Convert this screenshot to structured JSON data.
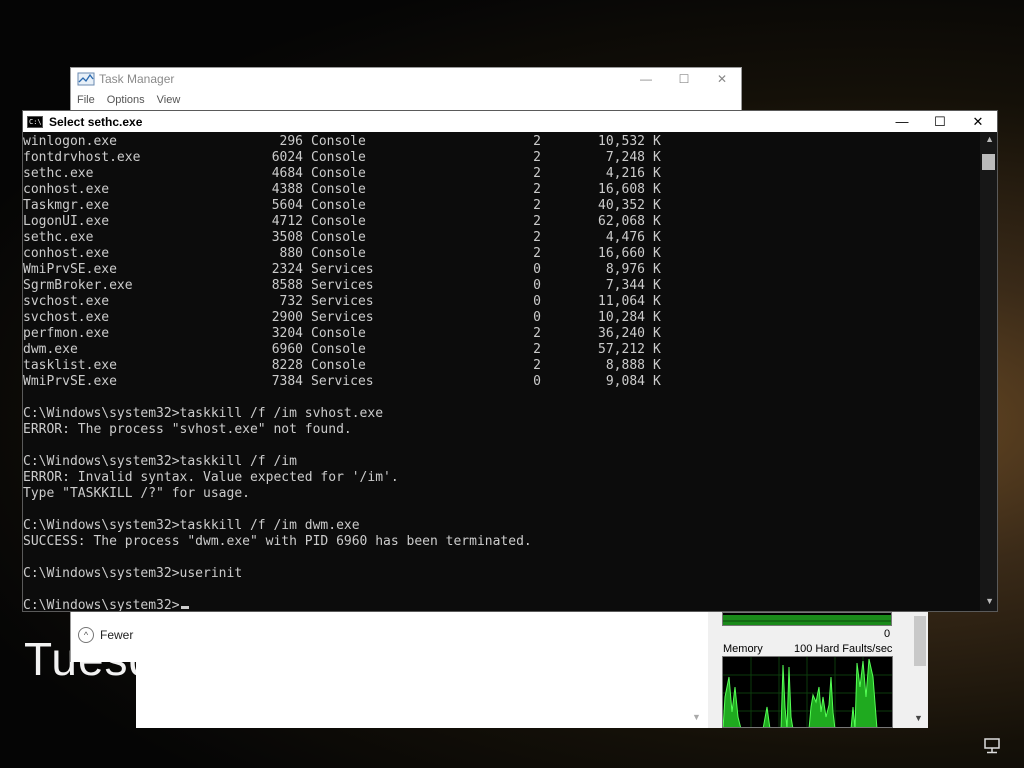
{
  "lock_screen": {
    "day_text": "Tuesd"
  },
  "task_manager": {
    "title": "Task Manager",
    "menu": [
      "File",
      "Options",
      "View"
    ],
    "fewer_details": "Fewer",
    "perf": {
      "zero_label": "0",
      "memory_label": "Memory",
      "faults_label": "100 Hard Faults/sec"
    }
  },
  "console": {
    "title": "Select sethc.exe",
    "processes": [
      {
        "name": "winlogon.exe",
        "pid": "296",
        "session": "Console",
        "num": "2",
        "mem": "10,532",
        "unit": "K"
      },
      {
        "name": "fontdrvhost.exe",
        "pid": "6024",
        "session": "Console",
        "num": "2",
        "mem": "7,248",
        "unit": "K"
      },
      {
        "name": "sethc.exe",
        "pid": "4684",
        "session": "Console",
        "num": "2",
        "mem": "4,216",
        "unit": "K"
      },
      {
        "name": "conhost.exe",
        "pid": "4388",
        "session": "Console",
        "num": "2",
        "mem": "16,608",
        "unit": "K"
      },
      {
        "name": "Taskmgr.exe",
        "pid": "5604",
        "session": "Console",
        "num": "2",
        "mem": "40,352",
        "unit": "K"
      },
      {
        "name": "LogonUI.exe",
        "pid": "4712",
        "session": "Console",
        "num": "2",
        "mem": "62,068",
        "unit": "K"
      },
      {
        "name": "sethc.exe",
        "pid": "3508",
        "session": "Console",
        "num": "2",
        "mem": "4,476",
        "unit": "K"
      },
      {
        "name": "conhost.exe",
        "pid": "880",
        "session": "Console",
        "num": "2",
        "mem": "16,660",
        "unit": "K"
      },
      {
        "name": "WmiPrvSE.exe",
        "pid": "2324",
        "session": "Services",
        "num": "0",
        "mem": "8,976",
        "unit": "K"
      },
      {
        "name": "SgrmBroker.exe",
        "pid": "8588",
        "session": "Services",
        "num": "0",
        "mem": "7,344",
        "unit": "K"
      },
      {
        "name": "svchost.exe",
        "pid": "732",
        "session": "Services",
        "num": "0",
        "mem": "11,064",
        "unit": "K"
      },
      {
        "name": "svchost.exe",
        "pid": "2900",
        "session": "Services",
        "num": "0",
        "mem": "10,284",
        "unit": "K"
      },
      {
        "name": "perfmon.exe",
        "pid": "3204",
        "session": "Console",
        "num": "2",
        "mem": "36,240",
        "unit": "K"
      },
      {
        "name": "dwm.exe",
        "pid": "6960",
        "session": "Console",
        "num": "2",
        "mem": "57,212",
        "unit": "K"
      },
      {
        "name": "tasklist.exe",
        "pid": "8228",
        "session": "Console",
        "num": "2",
        "mem": "8,888",
        "unit": "K"
      },
      {
        "name": "WmiPrvSE.exe",
        "pid": "7384",
        "session": "Services",
        "num": "0",
        "mem": "9,084",
        "unit": "K"
      }
    ],
    "lines": [
      "",
      "C:\\Windows\\system32>taskkill /f /im svhost.exe",
      "ERROR: The process \"svhost.exe\" not found.",
      "",
      "C:\\Windows\\system32>taskkill /f /im",
      "ERROR: Invalid syntax. Value expected for '/im'.",
      "Type \"TASKKILL /?\" for usage.",
      "",
      "C:\\Windows\\system32>taskkill /f /im dwm.exe",
      "SUCCESS: The process \"dwm.exe\" with PID 6960 has been terminated.",
      "",
      "C:\\Windows\\system32>userinit",
      ""
    ],
    "prompt": "C:\\Windows\\system32>"
  }
}
